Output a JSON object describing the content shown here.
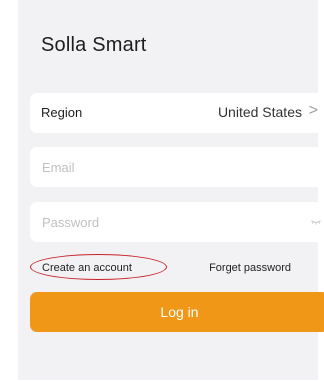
{
  "app": {
    "title": "Solla Smart"
  },
  "region": {
    "label": "Region",
    "value": "United States",
    "chevron": ">"
  },
  "email": {
    "placeholder": "Email",
    "value": ""
  },
  "password": {
    "placeholder": "Password",
    "value": "",
    "toggle_icon": "eye-closed-icon"
  },
  "links": {
    "create_account": "Create an account",
    "forget_password": "Forget password"
  },
  "login": {
    "label": "Log in"
  },
  "colors": {
    "accent": "#f19718",
    "highlight_circle": "#c8202a",
    "panel_bg": "#f2f2f4"
  }
}
